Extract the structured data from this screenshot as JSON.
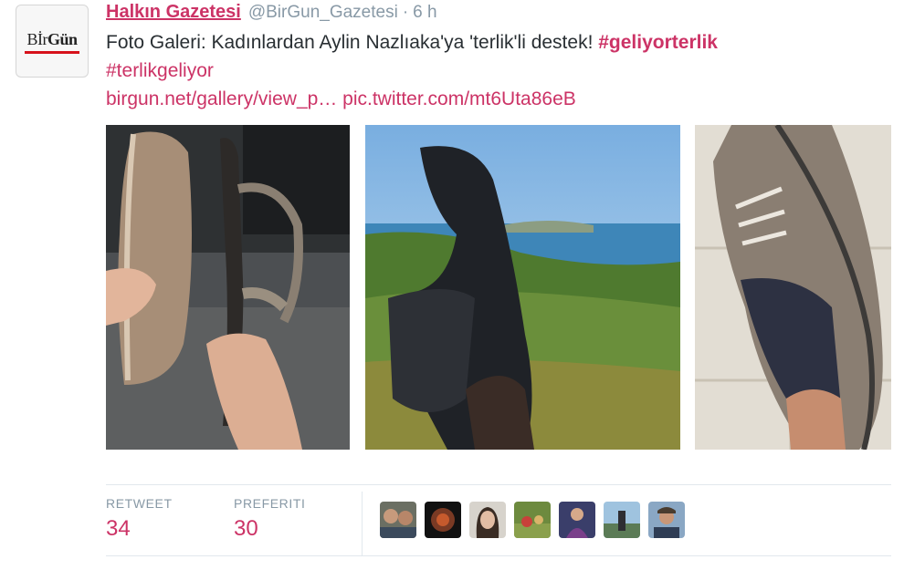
{
  "author": {
    "avatar_logo_part1": "Bİr",
    "avatar_logo_part2": "Gün",
    "name": "Halkın Gazetesi",
    "handle": "@BirGun_Gazetesi",
    "separator": "·",
    "time": "6 h"
  },
  "tweet": {
    "text_part1": "Foto Galeri: Kadınlardan Aylin Nazlıaka'ya 'terlik'li destek! ",
    "hashtag1": "#geliyorterlik",
    "hashtag2": "#terlikgeliyor",
    "link1": "birgun.net/gallery/view_p…",
    "link2": "pic.twitter.com/mt6Uta86eB"
  },
  "photos": [
    {
      "name": "espadrille-and-sandal-photo"
    },
    {
      "name": "black-shoe-over-sea-photo"
    },
    {
      "name": "grey-sneaker-photo"
    }
  ],
  "stats": {
    "retweet_label": "RETWEET",
    "retweet_count": "34",
    "favorite_label": "PREFERITI",
    "favorite_count": "30"
  },
  "favoriters": [
    "user-1",
    "user-2",
    "user-3",
    "user-4",
    "user-5",
    "user-6",
    "user-7"
  ],
  "colors": {
    "accent": "#cc3366",
    "meta": "#8899a6",
    "text": "#292f33",
    "divider": "#e1e8ed"
  }
}
